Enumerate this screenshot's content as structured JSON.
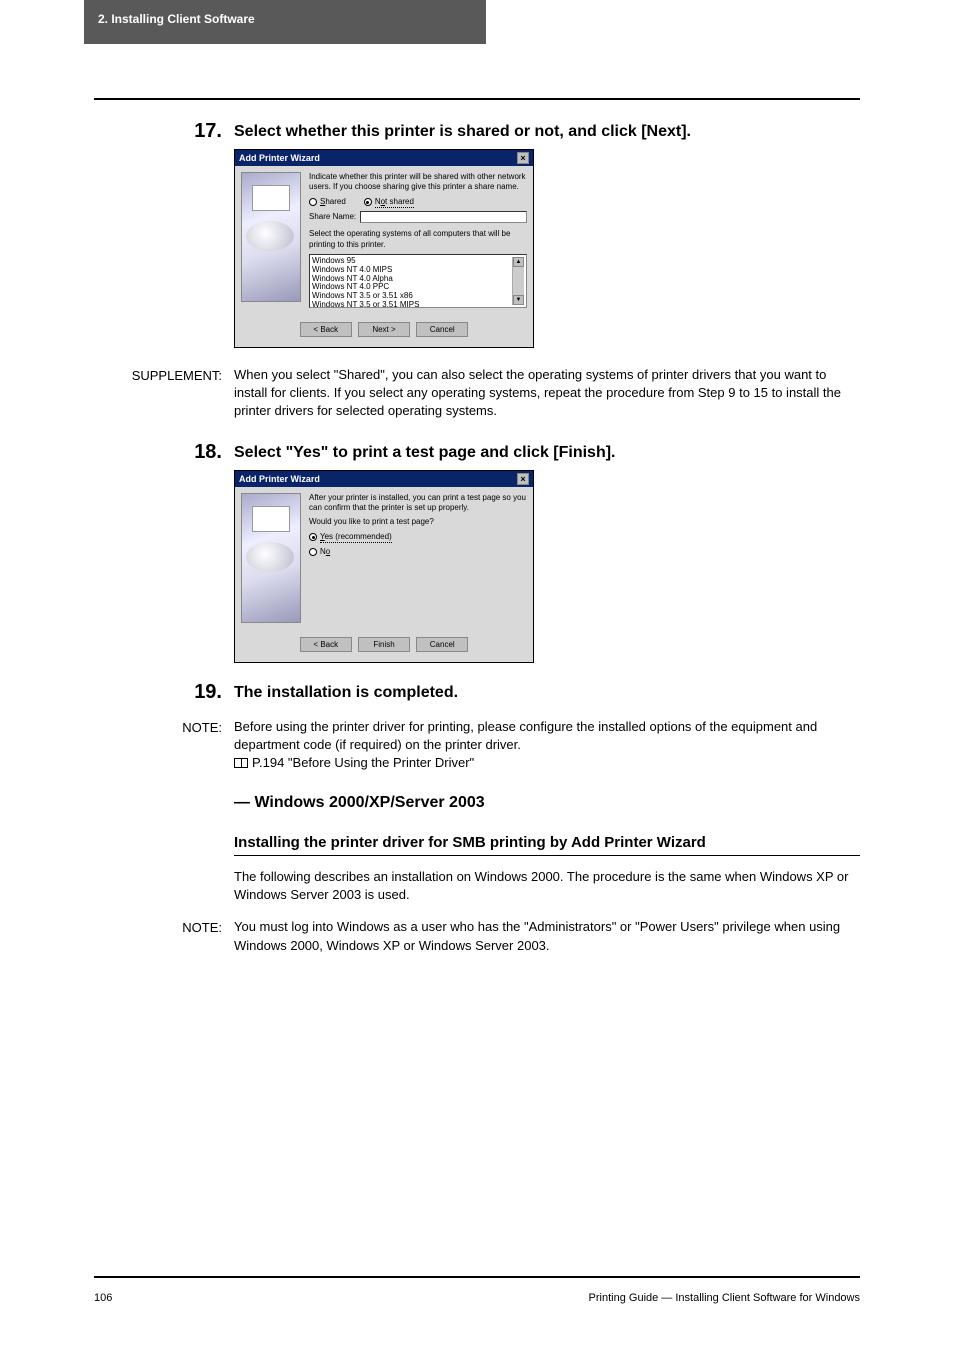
{
  "header": {
    "section_title": "2. Installing Client Software"
  },
  "step17": {
    "num": "17.",
    "text": "Select whether this printer is shared or not, and click [Next].",
    "dialog": {
      "title": "Add Printer Wizard",
      "intro": "Indicate whether this printer will be shared with other network users. If you choose sharing give this printer a share name.",
      "shared_label": "Shared",
      "not_shared_label": "Not shared",
      "share_name_label": "Share Name:",
      "os_instruction": "Select the operating systems of all computers that will be printing to this printer.",
      "os_list": [
        "Windows 95",
        "Windows NT 4.0 MIPS",
        "Windows NT 4.0 Alpha",
        "Windows NT 4.0 PPC",
        "Windows NT 3.5 or 3.51 x86",
        "Windows NT 3.5 or 3.51 MIPS"
      ],
      "back": "< Back",
      "next": "Next >",
      "cancel": "Cancel"
    }
  },
  "supplement": {
    "label": "SUPPLEMENT:",
    "text": "When you select \"Shared\", you can also select the operating systems of printer drivers that you want to install for clients. If you select any operating systems, repeat the procedure from Step 9 to 15 to install the printer drivers for selected operating systems."
  },
  "step18": {
    "num": "18.",
    "text": "Select \"Yes\" to print a test page and click [Finish].",
    "dialog": {
      "title": "Add Printer Wizard",
      "intro": "After your printer is installed, you can print a test page so you can confirm that the printer is set up properly.",
      "question": "Would you like to print a test page?",
      "yes_label": "Yes (recommended)",
      "no_label": "No",
      "back": "< Back",
      "finish": "Finish",
      "cancel": "Cancel"
    }
  },
  "step19": {
    "num": "19.",
    "text": "The installation is completed."
  },
  "note1": {
    "label": "NOTE:",
    "line1": "Before using the printer driver for printing, please configure the installed options of the equipment and department code (if required) on the printer driver.",
    "ref": "P.194 \"Before Using the Printer Driver\""
  },
  "heading_win": "— Windows 2000/XP/Server 2003",
  "heading_smb": "Installing the printer driver for SMB printing by Add Printer Wizard",
  "body_smb": "The following describes an installation on Windows 2000.  The procedure is the same when Windows XP or Windows Server 2003 is used.",
  "note2": {
    "label": "NOTE:",
    "text": "You must log into Windows as a user who has the \"Administrators\" or \"Power Users\" privilege when using Windows 2000, Windows XP or Windows Server 2003."
  },
  "footer": {
    "page": "106",
    "text": "Printing Guide — Installing Client Software for Windows"
  }
}
